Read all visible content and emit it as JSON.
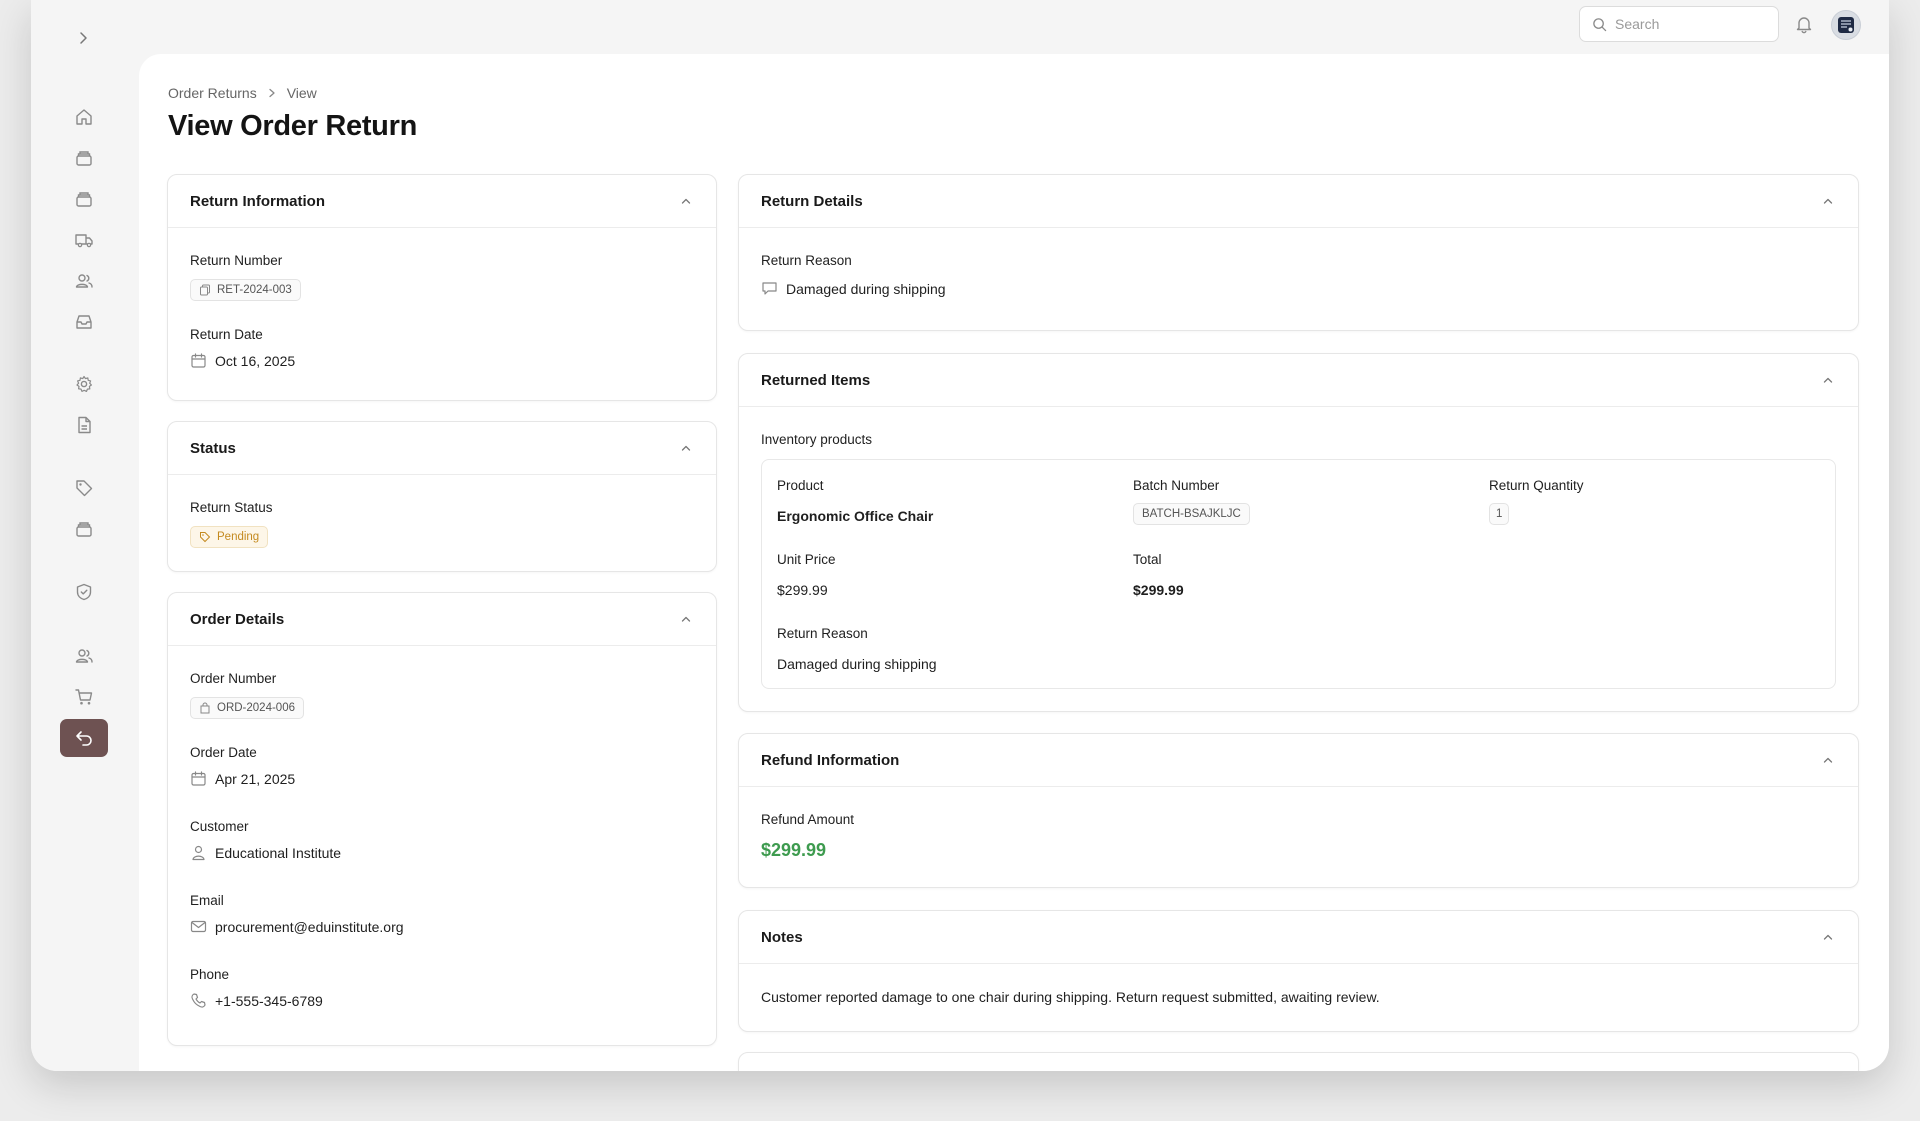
{
  "colors": {
    "accent": "#6e5252",
    "success": "#3e9b4f",
    "pending": "#c48a1f"
  },
  "topbar": {
    "search_placeholder": "Search",
    "bell_icon": "bell-icon",
    "avatar_icon": "avatar"
  },
  "sidebar": {
    "toggle_icon": "chevron-right-icon",
    "items": [
      {
        "icon": "home-icon"
      },
      {
        "icon": "archive-icon"
      },
      {
        "icon": "archive-icon"
      },
      {
        "icon": "truck-icon"
      },
      {
        "icon": "users-icon"
      },
      {
        "icon": "inbox-icon"
      },
      {
        "icon": "gear-icon"
      },
      {
        "icon": "file-icon"
      },
      {
        "icon": "tag-icon"
      },
      {
        "icon": "archive-icon"
      },
      {
        "icon": "shield-icon"
      },
      {
        "icon": "users-icon"
      },
      {
        "icon": "cart-icon"
      },
      {
        "icon": "return-icon",
        "active": true
      }
    ]
  },
  "breadcrumb": {
    "parent": "Order Returns",
    "current": "View"
  },
  "page": {
    "title": "View Order Return"
  },
  "return_info": {
    "title": "Return Information",
    "number_label": "Return Number",
    "number": "RET-2024-003",
    "date_label": "Return Date",
    "date": "Oct 16, 2025"
  },
  "status": {
    "title": "Status",
    "label": "Return Status",
    "value": "Pending"
  },
  "order_details": {
    "title": "Order Details",
    "number_label": "Order Number",
    "number": "ORD-2024-006",
    "date_label": "Order Date",
    "date": "Apr 21, 2025",
    "customer_label": "Customer",
    "customer": "Educational Institute",
    "email_label": "Email",
    "email": "procurement@eduinstitute.org",
    "phone_label": "Phone",
    "phone": "+1-555-345-6789"
  },
  "return_details": {
    "title": "Return Details",
    "reason_label": "Return Reason",
    "reason": "Damaged during shipping"
  },
  "returned_items": {
    "title": "Returned Items",
    "group_label": "Inventory products",
    "item": {
      "product_label": "Product",
      "product": "Ergonomic Office Chair",
      "batch_label": "Batch Number",
      "batch": "BATCH-BSAJKLJC",
      "qty_label": "Return Quantity",
      "qty": "1",
      "unit_price_label": "Unit Price",
      "unit_price": "$299.99",
      "total_label": "Total",
      "total": "$299.99",
      "reason_label": "Return Reason",
      "reason": "Damaged during shipping"
    }
  },
  "refund": {
    "title": "Refund Information",
    "amount_label": "Refund Amount",
    "amount": "$299.99"
  },
  "notes": {
    "title": "Notes",
    "text": "Customer reported damage to one chair during shipping. Return request submitted, awaiting review."
  }
}
